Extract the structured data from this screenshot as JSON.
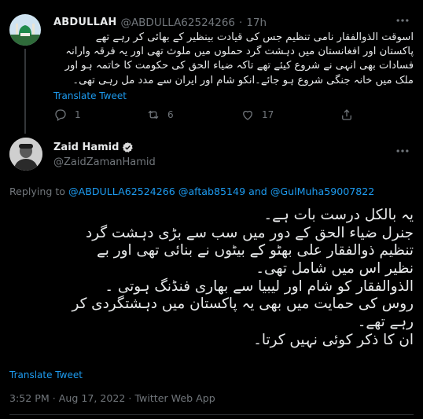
{
  "colors": {
    "background": "#000000",
    "text": "#e7e9ea",
    "muted": "#71767b",
    "link": "#1d9bf0",
    "divider": "#2f3336",
    "verified_badge": "#d9d9d9"
  },
  "parent_tweet": {
    "avatar_icon": "avatar-mosque-image",
    "name": "ABDULLAH",
    "handle": "@ABDULLA62524266",
    "separator": "·",
    "time": "17h",
    "more_icon": "more-horizontal-icon",
    "text_lines": [
      "اسوقت الذوالفقار نامی تنظیم جس کی قیادت بینظیر کے بھائی کر رہے تھے",
      "پاکستان اور افغانستان میں دہشت گرد حملوں میں ملوث تھی اور یہ فرقہ وارانہ",
      "فسادات بھی انہی نے شروع کیئے تھے تاکہ ضیاء الحق کی حکومت کا خاتمہ ہو اور",
      "ملک میں خانہ جنگی شروع ہو جائے۔انکو شام اور ایران سے مدد مل رہی تھی۔"
    ],
    "translate_label": "Translate Tweet",
    "actions": [
      {
        "icon": "reply-icon",
        "count": "1"
      },
      {
        "icon": "retweet-icon",
        "count": "6"
      },
      {
        "icon": "like-icon",
        "count": "17"
      },
      {
        "icon": "share-icon",
        "count": ""
      }
    ]
  },
  "main_tweet": {
    "avatar_icon": "avatar-photo",
    "name": "Zaid Hamid",
    "verified_icon": "verified-badge-icon",
    "handle": "@ZaidZamanHamid",
    "more_icon": "more-horizontal-icon",
    "replying_prefix": "Replying to",
    "replying_mentions": [
      "@ABDULLA62524266",
      "@aftab85149",
      "@GulMuha59007822"
    ],
    "replying_and": "and",
    "text_lines": [
      "یہ بالکل درست بات ہے۔",
      "جنرل ضیاء الحق کے دور میں سب سے بڑی دہشت گرد",
      "تنظیم ذوالفقار علی بھٹو کے بیٹوں نے بنائی تھی اور بے",
      "نظیر اس میں شامل تھی۔",
      "الذوالفقار کو شام اور لیبیا سے بھاری فنڈنگ ہوتی ۔",
      "روس کی حمایت میں بھی یہ پاکستان میں دہشتگردی کر",
      "رہے تھے۔",
      "ان کا ذکر کوئی نہیں کرتا۔"
    ],
    "translate_label": "Translate Tweet",
    "timestamp": "3:52 PM · Aug 17, 2022 · ",
    "app": "Twitter Web App"
  }
}
